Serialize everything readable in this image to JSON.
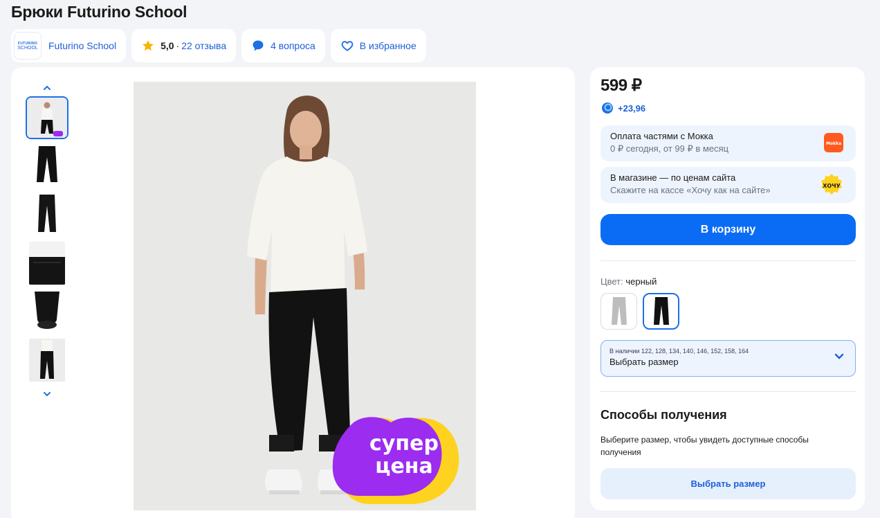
{
  "product": {
    "title": "Брюки Futurino School"
  },
  "brand": {
    "logo_line1": "FUTURINO",
    "logo_line2": "SCHOOL",
    "name": "Futurino School"
  },
  "rating": {
    "value": "5,0",
    "separator": "·",
    "reviews": "22 отзыва"
  },
  "questions": {
    "label": "4 вопроса"
  },
  "favorites": {
    "label": "В избранное"
  },
  "gallery": {
    "thumbnail_count": 6,
    "active_index": 0,
    "badge_text": [
      "супер",
      "цена"
    ]
  },
  "pricing": {
    "price": "599 ₽",
    "bonus": "+23,96"
  },
  "promos": {
    "mokka": {
      "title": "Оплата частями с Мокка",
      "subtitle": "0 ₽ сегодня, от 99 ₽ в месяц",
      "badge": "Mokka"
    },
    "store": {
      "title": "В магазине — по ценам сайта",
      "subtitle": "Скажите на кассе «Хочу как на сайте»",
      "badge": "ХОЧУ"
    }
  },
  "cart_button": "В корзину",
  "color": {
    "label": "Цвет:",
    "value": "черный",
    "options": [
      "серый",
      "черный"
    ],
    "selected": 1
  },
  "size": {
    "available": "В наличии 122, 128, 134, 140, 146, 152, 158, 164",
    "placeholder": "Выбрать размер"
  },
  "delivery": {
    "title": "Способы получения",
    "text": "Выберите размер, чтобы увидеть доступные способы получения",
    "button": "Выбрать размер"
  },
  "colors": {
    "accent": "#0a6cf5",
    "link": "#1c5fd9",
    "promo_bg": "#eef4fd",
    "page_bg": "#f2f4f7",
    "badge_purple": "#9b2cf0",
    "badge_yellow": "#ffd21f"
  }
}
